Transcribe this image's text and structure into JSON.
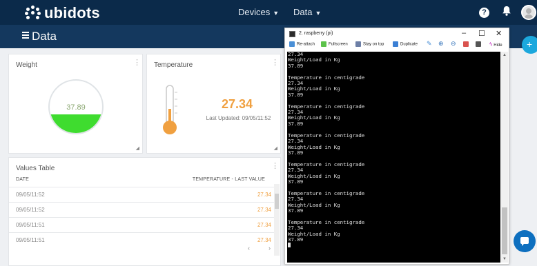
{
  "nav": {
    "logo": "ubidots",
    "devices_label": "Devices",
    "data_label": "Data",
    "help_label": "?"
  },
  "page": {
    "title": "Data"
  },
  "weight_widget": {
    "title": "Weight",
    "value": "37.89",
    "level": 0.36
  },
  "temperature_widget": {
    "title": "Temperature",
    "value": "27.34",
    "last_updated": "Last Updated: 09/05/11:52"
  },
  "values_table": {
    "title": "Values Table",
    "col_date": "DATE",
    "col_value": "TEMPERATURE - LAST VALUE",
    "rows": [
      {
        "date": "09/05/11:52",
        "value": "27.34"
      },
      {
        "date": "09/05/11:52",
        "value": "27.34"
      },
      {
        "date": "09/05/11:51",
        "value": "27.34"
      },
      {
        "date": "09/05/11:51",
        "value": "27.34"
      }
    ],
    "prev": "‹",
    "next": "›"
  },
  "terminal": {
    "title": "2. raspberry (pi)",
    "toolbar": {
      "reattach": "Re-attach",
      "fullscreen": "Fullscreen",
      "stay_on_top": "Stay on top",
      "duplicate": "Duplicate",
      "hide": "Hide"
    },
    "lines": [
      "27.34",
      "Weight/Load in Kg",
      "37.89",
      "",
      "Temperature in centigrade",
      "27.34",
      "Weight/Load in Kg",
      "37.89",
      "",
      "Temperature in centigrade",
      "27.34",
      "Weight/Load in Kg",
      "37.89",
      "",
      "Temperature in centigrade",
      "27.34",
      "Weight/Load in Kg",
      "37.89",
      "",
      "Temperature in centigrade",
      "27.34",
      "Weight/Load in Kg",
      "37.89",
      "",
      "Temperature in centigrade",
      "27.34",
      "Weight/Load in Kg",
      "37.89",
      "",
      "Temperature in centigrade",
      "27.34",
      "Weight/Load in Kg",
      "37.89"
    ]
  },
  "fab": {
    "add_label": "+"
  },
  "colors": {
    "nav_bg": "#0b2a4a",
    "subbar_bg": "#14385e",
    "gauge_fill": "#3fdc2f",
    "accent_orange": "#f0a040",
    "fab_blue": "#1ca8dd"
  }
}
